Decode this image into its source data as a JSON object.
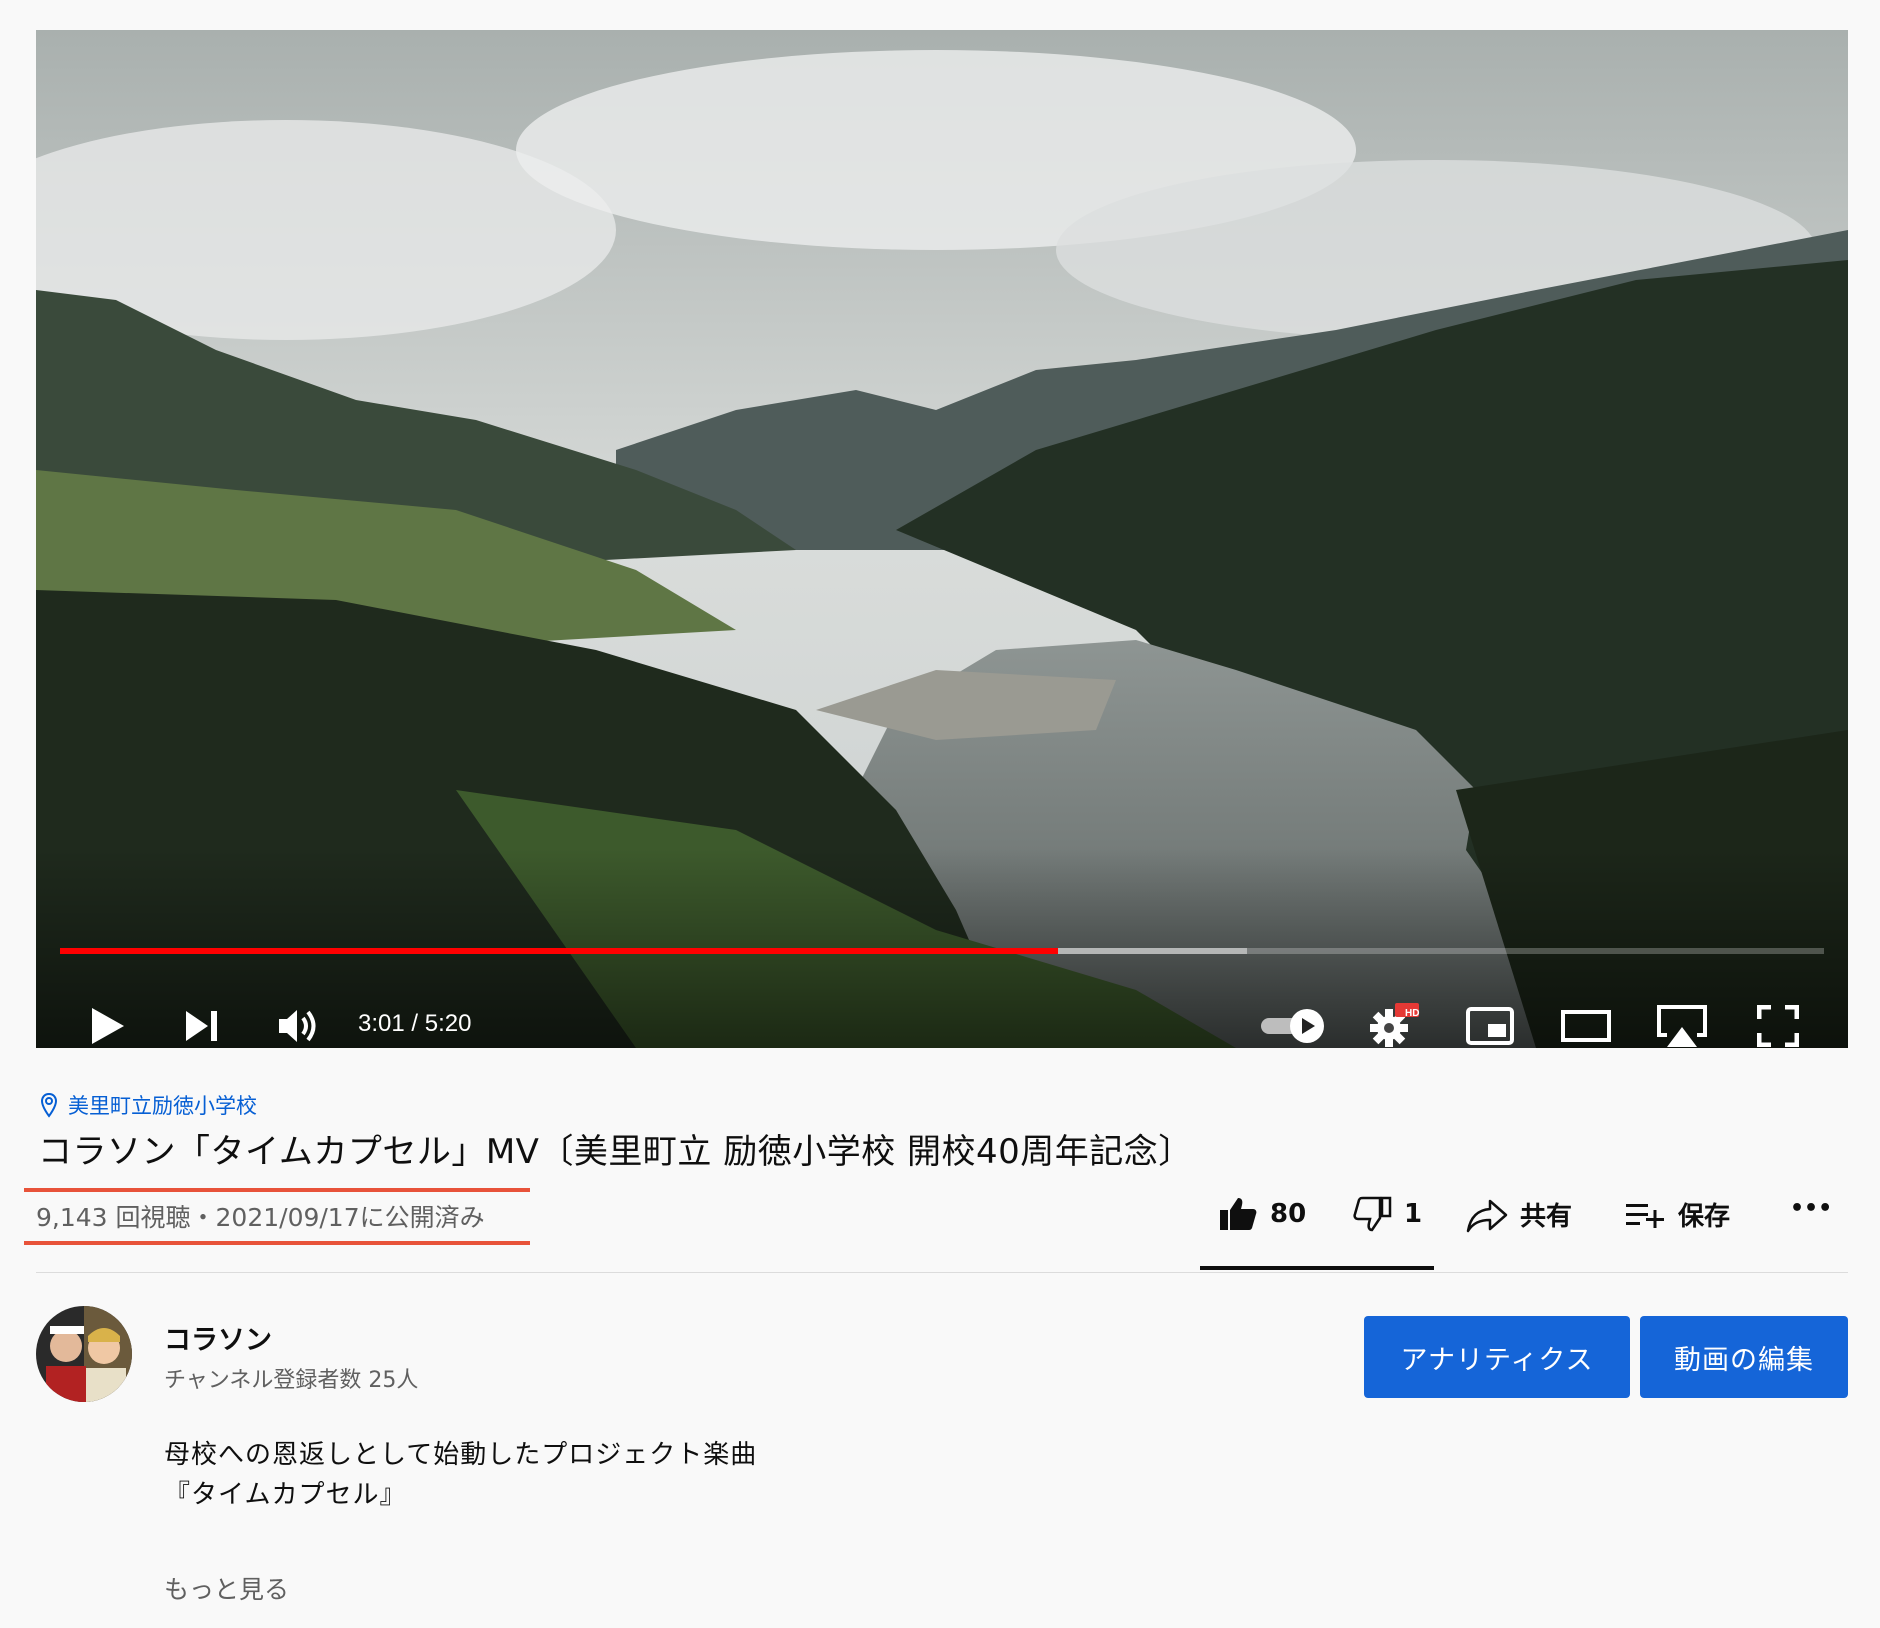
{
  "player": {
    "progress_played": 0.566,
    "progress_buffered": 0.673,
    "time": "3:01 / 5:20",
    "icons": [
      "play-icon",
      "next-icon",
      "volume-icon",
      "autoplay-toggle-icon",
      "settings-icon",
      "miniplayer-icon",
      "theater-mode-icon",
      "airplay-icon",
      "fullscreen-icon"
    ],
    "hd_badge": "HD"
  },
  "video": {
    "location": "美里町立励徳小学校",
    "title": "コラソン「タイムカプセル」MV〔美里町立 励徳小学校 開校40周年記念〕",
    "meta": "9,143 回視聴・2021/09/17に公開済み"
  },
  "actions": {
    "like_count": "80",
    "dislike_count": "1",
    "share_label": "共有",
    "save_label": "保存",
    "more_label": "•••"
  },
  "channel": {
    "name": "コラソン",
    "subscribers": "チャンネル登録者数 25人",
    "analytics_label": "アナリティクス",
    "edit_label": "動画の編集"
  },
  "description": {
    "line1": "母校への恩返しとして始動したプロジェクト楽曲",
    "line2": "『タイムカプセル』",
    "more_label": "もっと見る"
  },
  "colors": {
    "accent_blue": "#1565d8",
    "progress_red": "#ff0000",
    "annotation_red": "#e8533a"
  }
}
